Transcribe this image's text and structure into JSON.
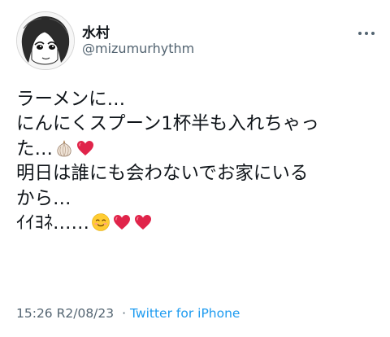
{
  "user": {
    "display_name": "水村",
    "handle": "@mizumurhythm"
  },
  "tweet": {
    "line1": "ラーメンに…",
    "line2": "にんにくスプーン1杯半も入れちゃっ",
    "line3": "た…",
    "line4": "明日は誰にも会わないでお家にいる",
    "line5": "から…",
    "line6": "ｲｲﾖﾈ……"
  },
  "footer": {
    "time": "15:26",
    "date": "R2/08/23",
    "separator": "·",
    "source": "Twitter for iPhone"
  }
}
